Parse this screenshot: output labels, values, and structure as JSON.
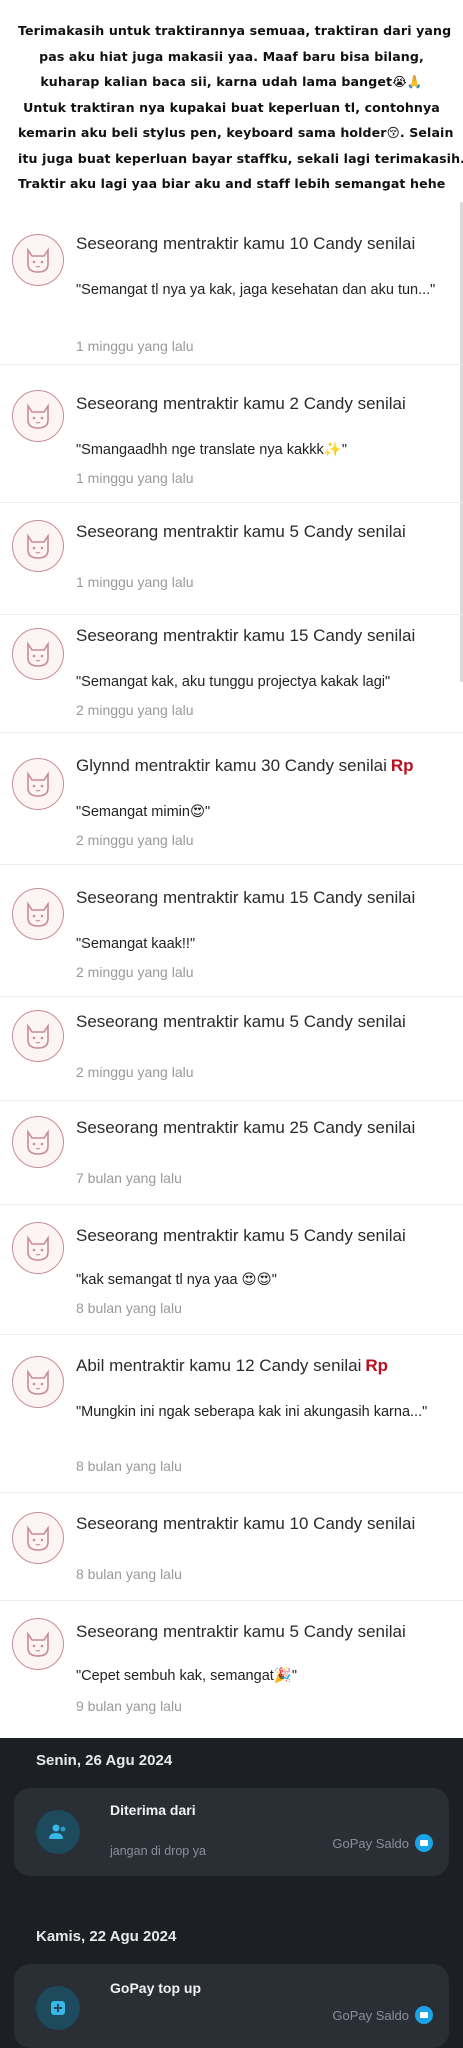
{
  "note": {
    "lines": [
      "Terimakasih untuk traktirannya semuaa, traktiran dari yang",
      "pas aku hiat juga makasii yaa. Maaf baru bisa bilang,",
      "kuharap kalian baca sii, karna udah lama banget😭🙏",
      "Untuk traktiran nya kupakai buat keperluan tl, contohnya",
      "kemarin aku beli stylus pen, keyboard sama holder😚. Selain",
      "itu juga buat keperluan bayar staffku, sekali lagi terimakasih.",
      "Traktir aku lagi yaa biar aku and staff lebih semangat hehe"
    ]
  },
  "feed": [
    {
      "title": "Seseorang mentraktir kamu 10 Candy senilai",
      "rp": "",
      "message": "\"Semangat tl nya ya kak, jaga kesehatan dan aku tun...\"",
      "time": "1 minggu yang lalu"
    },
    {
      "title": "Seseorang mentraktir kamu 2 Candy senilai",
      "rp": "",
      "message": "\"Smangaadhh nge translate nya kakkk✨\"",
      "time": "1 minggu yang lalu"
    },
    {
      "title": "Seseorang mentraktir kamu 5 Candy senilai",
      "rp": "",
      "message": "",
      "time": "1 minggu yang lalu"
    },
    {
      "title": "Seseorang mentraktir kamu 15 Candy senilai",
      "rp": "",
      "message": "\"Semangat kak, aku tunggu projectya kakak lagi\"",
      "time": "2 minggu yang lalu"
    },
    {
      "title": "Glynnd mentraktir kamu 30 Candy senilai",
      "rp": "Rp",
      "message": "\"Semangat mimin😍\"",
      "time": "2 minggu yang lalu"
    },
    {
      "title": "Seseorang mentraktir kamu 15 Candy senilai",
      "rp": "",
      "message": "\"Semangat kaak!!\"",
      "time": "2 minggu yang lalu"
    },
    {
      "title": "Seseorang mentraktir kamu 5 Candy senilai",
      "rp": "",
      "message": "",
      "time": "2 minggu yang lalu"
    },
    {
      "title": "Seseorang mentraktir kamu 25 Candy senilai",
      "rp": "",
      "message": "",
      "time": "7 bulan yang lalu"
    },
    {
      "title": "Seseorang mentraktir kamu 5 Candy senilai",
      "rp": "",
      "message": "\"kak semangat tl nya yaa 😍😍\"",
      "time": "8 bulan yang lalu"
    },
    {
      "title": "Abil mentraktir kamu 12 Candy senilai",
      "rp": "Rp",
      "message": "\"Mungkin ini ngak seberapa kak ini akungasih karna...\"",
      "time": "8 bulan yang lalu"
    },
    {
      "title": "Seseorang mentraktir kamu 10 Candy senilai",
      "rp": "",
      "message": "",
      "time": "8 bulan yang lalu"
    },
    {
      "title": "Seseorang mentraktir kamu 5 Candy senilai",
      "rp": "",
      "message": "\"Cepet sembuh kak, semangat🎉\"",
      "time": "9 bulan yang lalu"
    }
  ],
  "gopay": {
    "groups": [
      {
        "date": "Senin, 26 Agu 2024",
        "title": "Diterima dari",
        "subtitle": "jangan di drop ya",
        "wallet": "GoPay Saldo",
        "icon": "users-icon"
      },
      {
        "date": "Kamis, 22 Agu 2024",
        "title": "GoPay top up",
        "subtitle": "",
        "wallet": "GoPay Saldo",
        "icon": "plus-icon"
      }
    ]
  },
  "colors": {
    "rp_red": "#b8101f",
    "dark_bg": "#1c1f24",
    "card_bg": "#2a2e35",
    "gopay_blue": "#1aa3e6"
  }
}
